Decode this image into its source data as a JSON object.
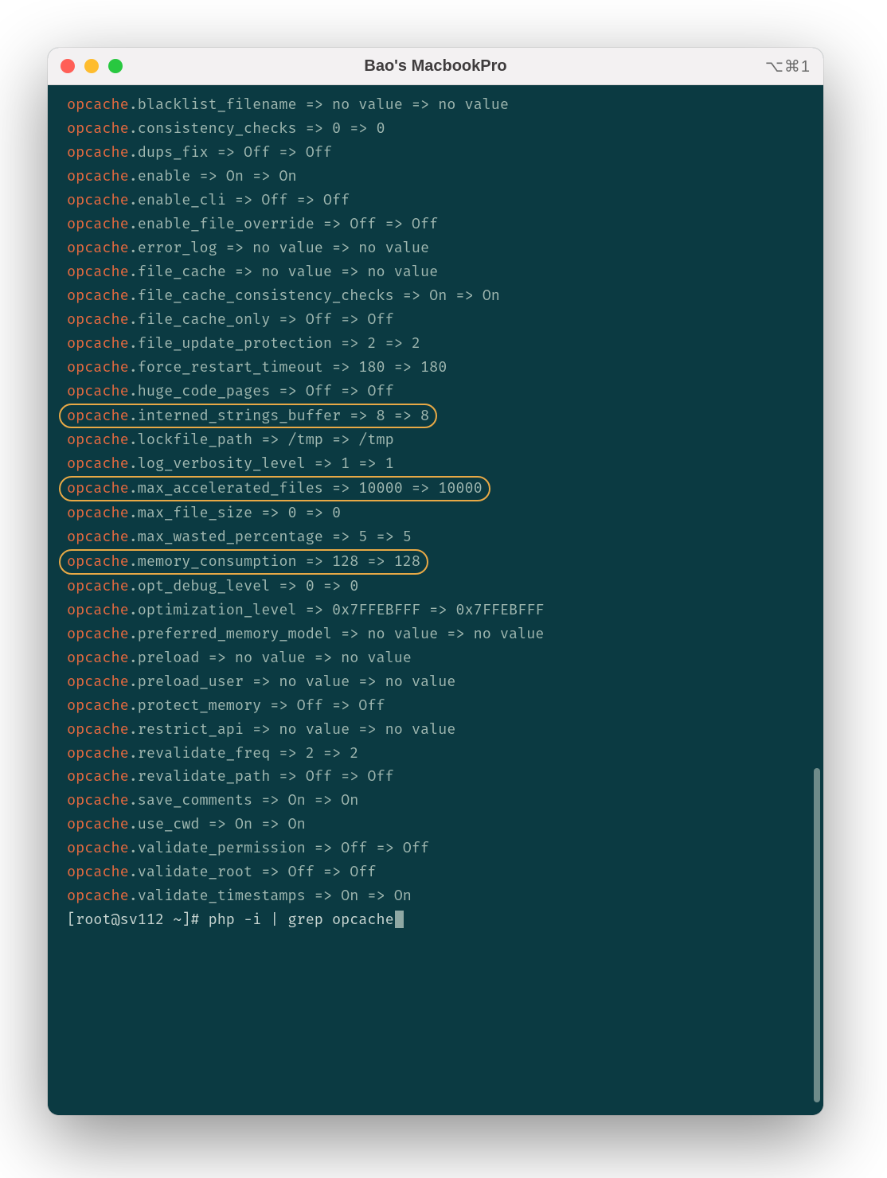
{
  "window": {
    "title": "Bao's MacbookPro",
    "shortcut": "⌥⌘1"
  },
  "terminal": {
    "keyword": "opcache",
    "lines": [
      {
        "rest": ".blacklist_filename => no value => no value",
        "hl": false
      },
      {
        "rest": ".consistency_checks => 0 => 0",
        "hl": false
      },
      {
        "rest": ".dups_fix => Off => Off",
        "hl": false
      },
      {
        "rest": ".enable => On => On",
        "hl": false
      },
      {
        "rest": ".enable_cli => Off => Off",
        "hl": false
      },
      {
        "rest": ".enable_file_override => Off => Off",
        "hl": false
      },
      {
        "rest": ".error_log => no value => no value",
        "hl": false
      },
      {
        "rest": ".file_cache => no value => no value",
        "hl": false
      },
      {
        "rest": ".file_cache_consistency_checks => On => On",
        "hl": false
      },
      {
        "rest": ".file_cache_only => Off => Off",
        "hl": false
      },
      {
        "rest": ".file_update_protection => 2 => 2",
        "hl": false
      },
      {
        "rest": ".force_restart_timeout => 180 => 180",
        "hl": false
      },
      {
        "rest": ".huge_code_pages => Off => Off",
        "hl": false
      },
      {
        "rest": ".interned_strings_buffer => 8 => 8",
        "hl": true
      },
      {
        "rest": ".lockfile_path => /tmp => /tmp",
        "hl": false
      },
      {
        "rest": ".log_verbosity_level => 1 => 1",
        "hl": false
      },
      {
        "rest": ".max_accelerated_files => 10000 => 10000",
        "hl": true
      },
      {
        "rest": ".max_file_size => 0 => 0",
        "hl": false
      },
      {
        "rest": ".max_wasted_percentage => 5 => 5",
        "hl": false
      },
      {
        "rest": ".memory_consumption => 128 => 128",
        "hl": true
      },
      {
        "rest": ".opt_debug_level => 0 => 0",
        "hl": false
      },
      {
        "rest": ".optimization_level => 0x7FFEBFFF => 0x7FFEBFFF",
        "hl": false
      },
      {
        "rest": ".preferred_memory_model => no value => no value",
        "hl": false
      },
      {
        "rest": ".preload => no value => no value",
        "hl": false
      },
      {
        "rest": ".preload_user => no value => no value",
        "hl": false
      },
      {
        "rest": ".protect_memory => Off => Off",
        "hl": false
      },
      {
        "rest": ".restrict_api => no value => no value",
        "hl": false
      },
      {
        "rest": ".revalidate_freq => 2 => 2",
        "hl": false
      },
      {
        "rest": ".revalidate_path => Off => Off",
        "hl": false
      },
      {
        "rest": ".save_comments => On => On",
        "hl": false
      },
      {
        "rest": ".use_cwd => On => On",
        "hl": false
      },
      {
        "rest": ".validate_permission => Off => Off",
        "hl": false
      },
      {
        "rest": ".validate_root => Off => Off",
        "hl": false
      },
      {
        "rest": ".validate_timestamps => On => On",
        "hl": false
      }
    ],
    "prompt": "[root@sv112 ~]# php -i | grep opcache"
  }
}
